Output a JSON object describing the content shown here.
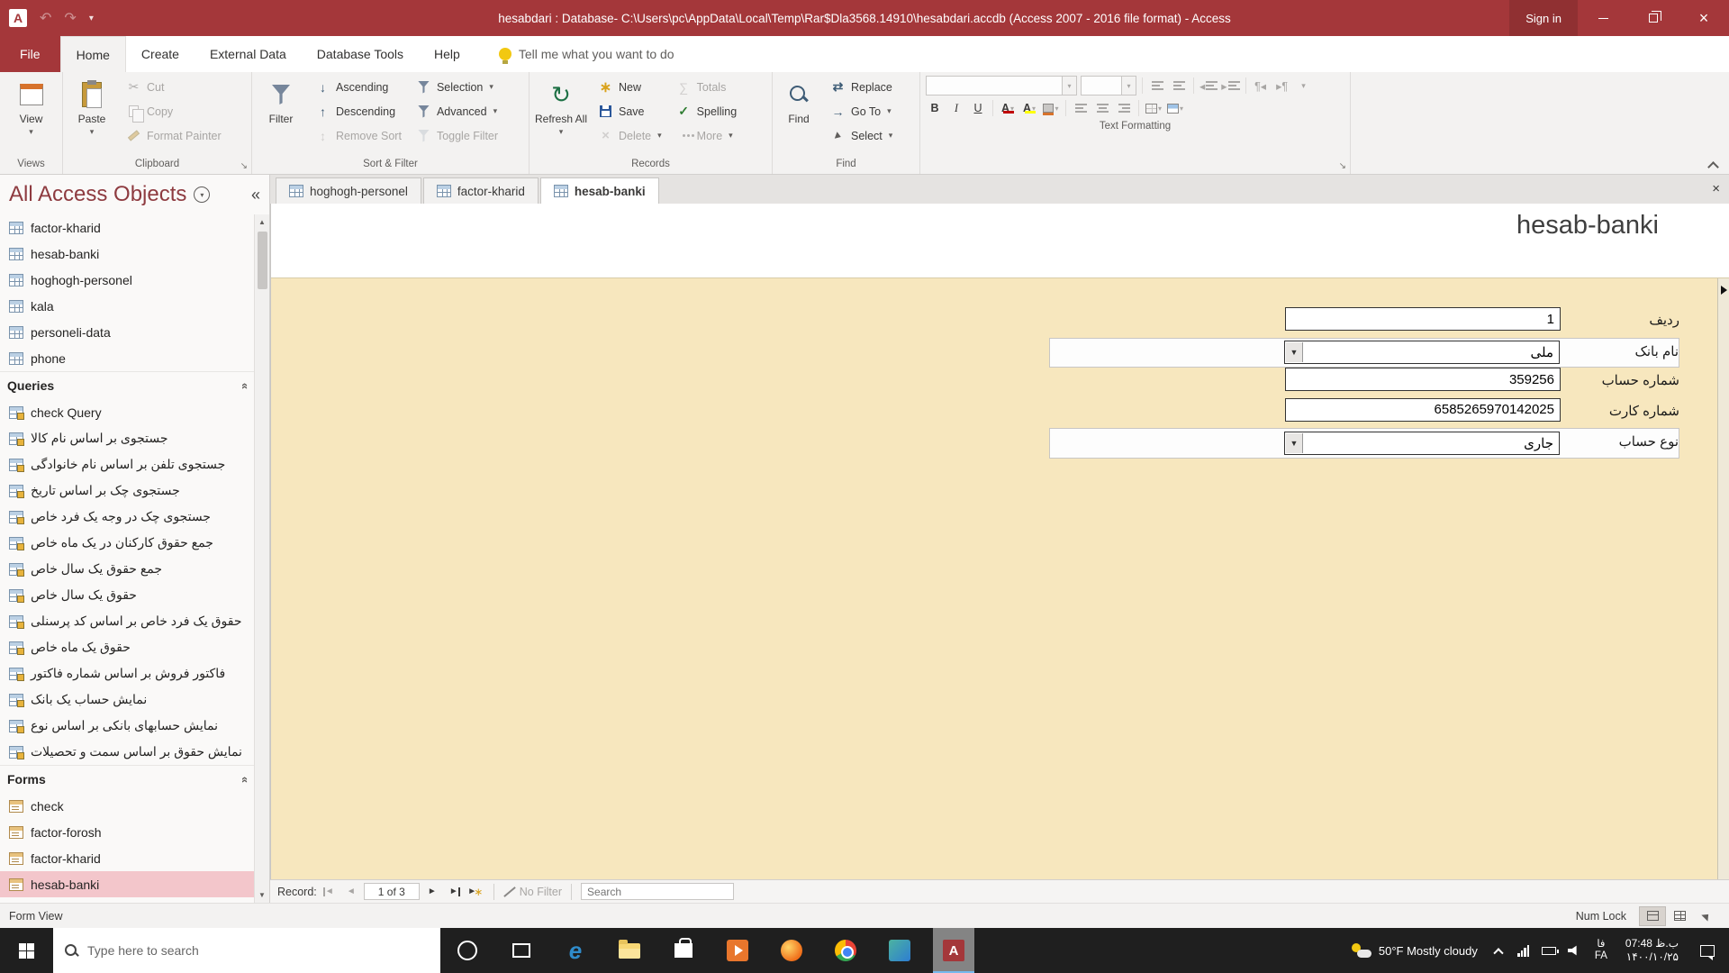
{
  "colors": {
    "accent": "#A4373A",
    "form_background": "#F7E7BE",
    "nav_selection": "#F3C6CB"
  },
  "titlebar": {
    "title": "hesabdari : Database- C:\\Users\\pc\\AppData\\Local\\Temp\\Rar$Dla3568.14910\\hesabdari.accdb (Access 2007 - 2016 file format)  -  Access",
    "sign_in": "Sign in"
  },
  "menubar": {
    "tabs": [
      {
        "label": "File",
        "cls": "file"
      },
      {
        "label": "Home",
        "cls": "active"
      },
      {
        "label": "Create"
      },
      {
        "label": "External Data"
      },
      {
        "label": "Database Tools"
      },
      {
        "label": "Help"
      }
    ],
    "tell_me": "Tell me what you want to do"
  },
  "ribbon": {
    "views": {
      "label": "Views",
      "view": "View"
    },
    "clipboard": {
      "label": "Clipboard",
      "paste": "Paste",
      "cut": "Cut",
      "copy": "Copy",
      "format_painter": "Format Painter"
    },
    "sort_filter": {
      "label": "Sort & Filter",
      "filter": "Filter",
      "ascending": "Ascending",
      "descending": "Descending",
      "remove_sort": "Remove Sort",
      "selection": "Selection",
      "advanced": "Advanced",
      "toggle_filter": "Toggle Filter"
    },
    "records": {
      "label": "Records",
      "refresh_all": "Refresh All",
      "new": "New",
      "save": "Save",
      "delete": "Delete",
      "totals": "Totals",
      "spelling": "Spelling",
      "more": "More"
    },
    "find": {
      "label": "Find",
      "find": "Find",
      "replace": "Replace",
      "go_to": "Go To",
      "select": "Select"
    },
    "text_formatting": {
      "label": "Text Formatting",
      "bold": "B",
      "italic": "I",
      "underline": "U",
      "font_color": "A",
      "highlight": "A"
    }
  },
  "sidebar": {
    "title": "All Access Objects",
    "tables": [
      "factor-kharid",
      "hesab-banki",
      "hoghogh-personel",
      "kala",
      "personeli-data",
      "phone"
    ],
    "queries_header": "Queries",
    "queries": [
      "check Query",
      "جستجوی بر اساس نام کالا",
      "جستجوی تلفن بر اساس نام خانوادگی",
      "جستجوی چک بر اساس تاریخ",
      "جستجوی چک در وجه یک فرد خاص",
      "جمع حقوق کارکنان در یک ماه خاص",
      "جمع حقوق یک سال خاص",
      "حقوق یک سال خاص",
      "حقوق یک فرد خاص بر اساس کد پرسنلی",
      "حقوق یک ماه خاص",
      "فاکتور فروش بر اساس شماره فاکتور",
      "نمایش حساب یک بانک",
      "نمایش حسابهای بانکی بر اساس نوع",
      "نمایش حقوق بر اساس سمت و تحصیلات"
    ],
    "forms_header": "Forms",
    "forms": [
      {
        "label": "check"
      },
      {
        "label": "factor-forosh"
      },
      {
        "label": "factor-kharid"
      },
      {
        "label": "hesab-banki",
        "cls": "selected"
      }
    ]
  },
  "doc_tabs": [
    {
      "label": "hoghogh-personel"
    },
    {
      "label": "factor-kharid"
    },
    {
      "label": "hesab-banki",
      "cls": "active"
    }
  ],
  "form": {
    "title": "hesab-banki",
    "fields": [
      {
        "label": "ردیف",
        "value": "1"
      },
      {
        "label": "نام بانک",
        "value": "ملی",
        "cls": "combo"
      },
      {
        "label": "شماره حساب",
        "value": "359256"
      },
      {
        "label": "شماره کارت",
        "value": "6585265970142025"
      },
      {
        "label": "نوع حساب",
        "value": "جاری",
        "cls": "combo"
      }
    ]
  },
  "record_nav": {
    "label": "Record:",
    "position": "1 of 3",
    "no_filter": "No Filter",
    "search_placeholder": "Search"
  },
  "status": {
    "left": "Form View",
    "num_lock": "Num Lock"
  },
  "taskbar": {
    "search_placeholder": "Type here to search",
    "weather": "50°F Mostly cloudy",
    "lang_fa": "فا",
    "lang_en": "FA",
    "time": "07:48 ب.ظ",
    "date": "۱۴۰۰/۱۰/۲۵"
  }
}
